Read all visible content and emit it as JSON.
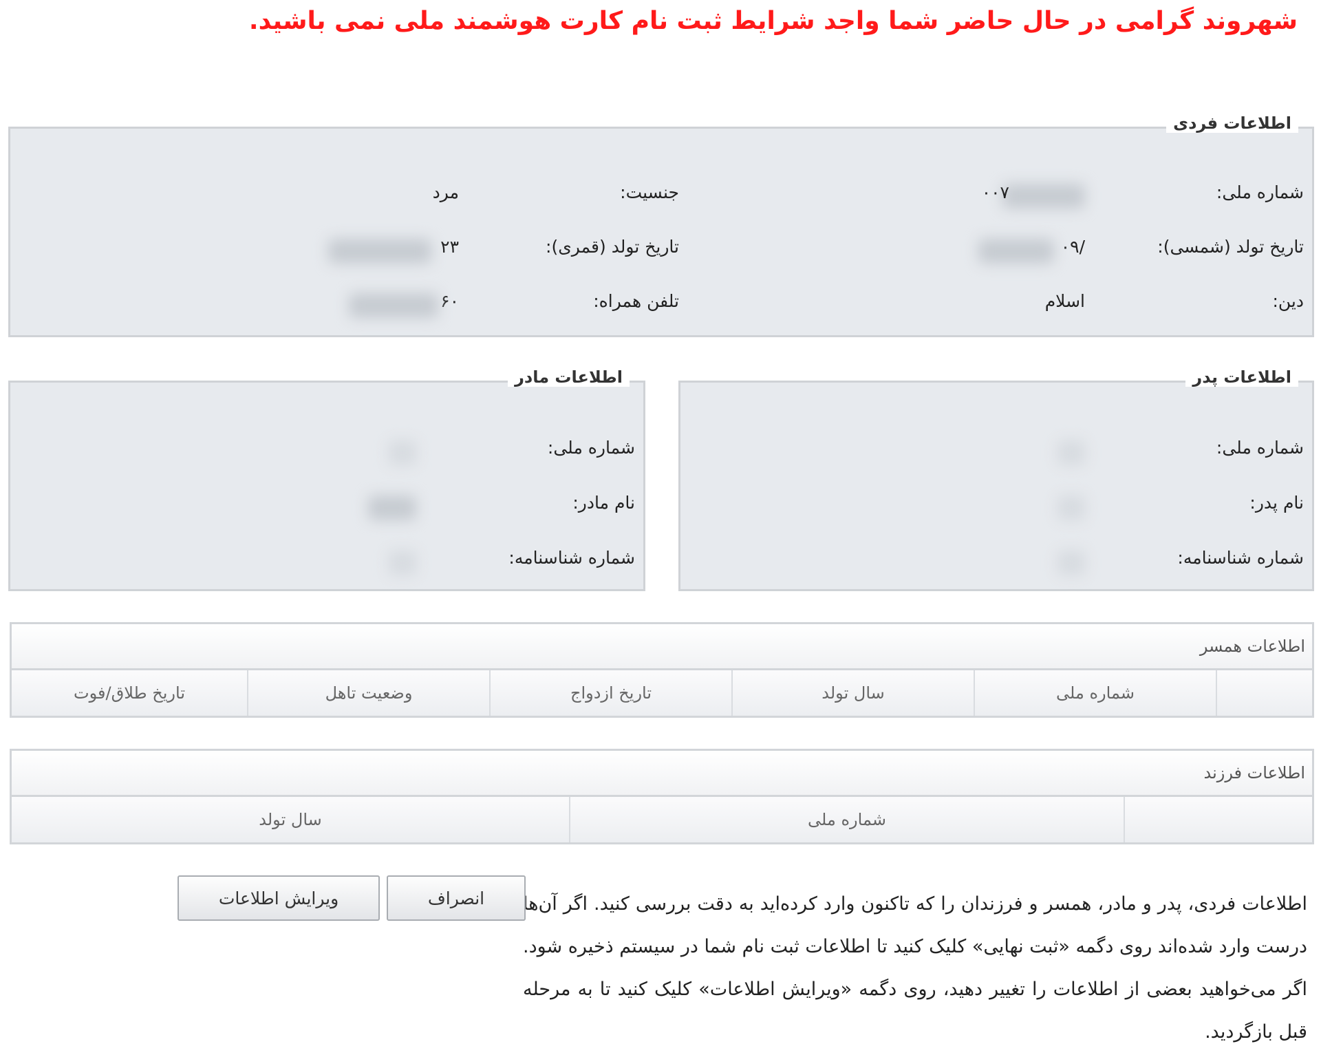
{
  "notice": "شهروند گرامی در حال حاضر شما واجد شرایط ثبت نام کارت هوشمند ملی نمی باشید.",
  "personal": {
    "legend": "اطلاعات فردی",
    "national_id_label": "شماره ملی:",
    "national_id_value": "۰۰۷",
    "gender_label": "جنسیت:",
    "gender_value": "مرد",
    "birth_solar_label": "تاریخ تولد (شمسی):",
    "birth_solar_value": "/۰۹",
    "birth_lunar_label": "تاریخ تولد (قمری):",
    "birth_lunar_value": "۲۳",
    "religion_label": "دین:",
    "religion_value": "اسلام",
    "mobile_label": "تلفن همراه:",
    "mobile_value": "۶۰"
  },
  "father": {
    "legend": "اطلاعات پدر",
    "national_id_label": "شماره ملی:",
    "name_label": "نام پدر:",
    "birth_cert_label": "شماره شناسنامه:"
  },
  "mother": {
    "legend": "اطلاعات مادر",
    "national_id_label": "شماره ملی:",
    "name_label": "نام مادر:",
    "birth_cert_label": "شماره شناسنامه:"
  },
  "spouse": {
    "title": "اطلاعات همسر",
    "columns": [
      "",
      "شماره ملی",
      "سال تولد",
      "تاریخ ازدواج",
      "وضعیت تاهل",
      "تاریخ طلاق/فوت"
    ]
  },
  "children": {
    "title": "اطلاعات فرزند",
    "columns": [
      "",
      "شماره ملی",
      "سال تولد"
    ]
  },
  "instructions": "اطلاعات فردی، پدر و مادر، همسر و فرزندان را که تاکنون وارد کرده‌اید به دقت بررسی کنید. اگر آن‌ها درست وارد شده‌اند روی دگمه «ثبت نهایی» کلیک کنید تا اطلاعات ثبت نام شما در سیستم ذخیره شود. اگر می‌خواهید بعضی از اطلاعات را تغییر دهید، روی دگمه «ویرایش اطلاعات» کلیک کنید تا به مرحله قبل بازگردید.",
  "buttons": {
    "cancel": "انصراف",
    "edit": "ویرایش اطلاعات"
  }
}
